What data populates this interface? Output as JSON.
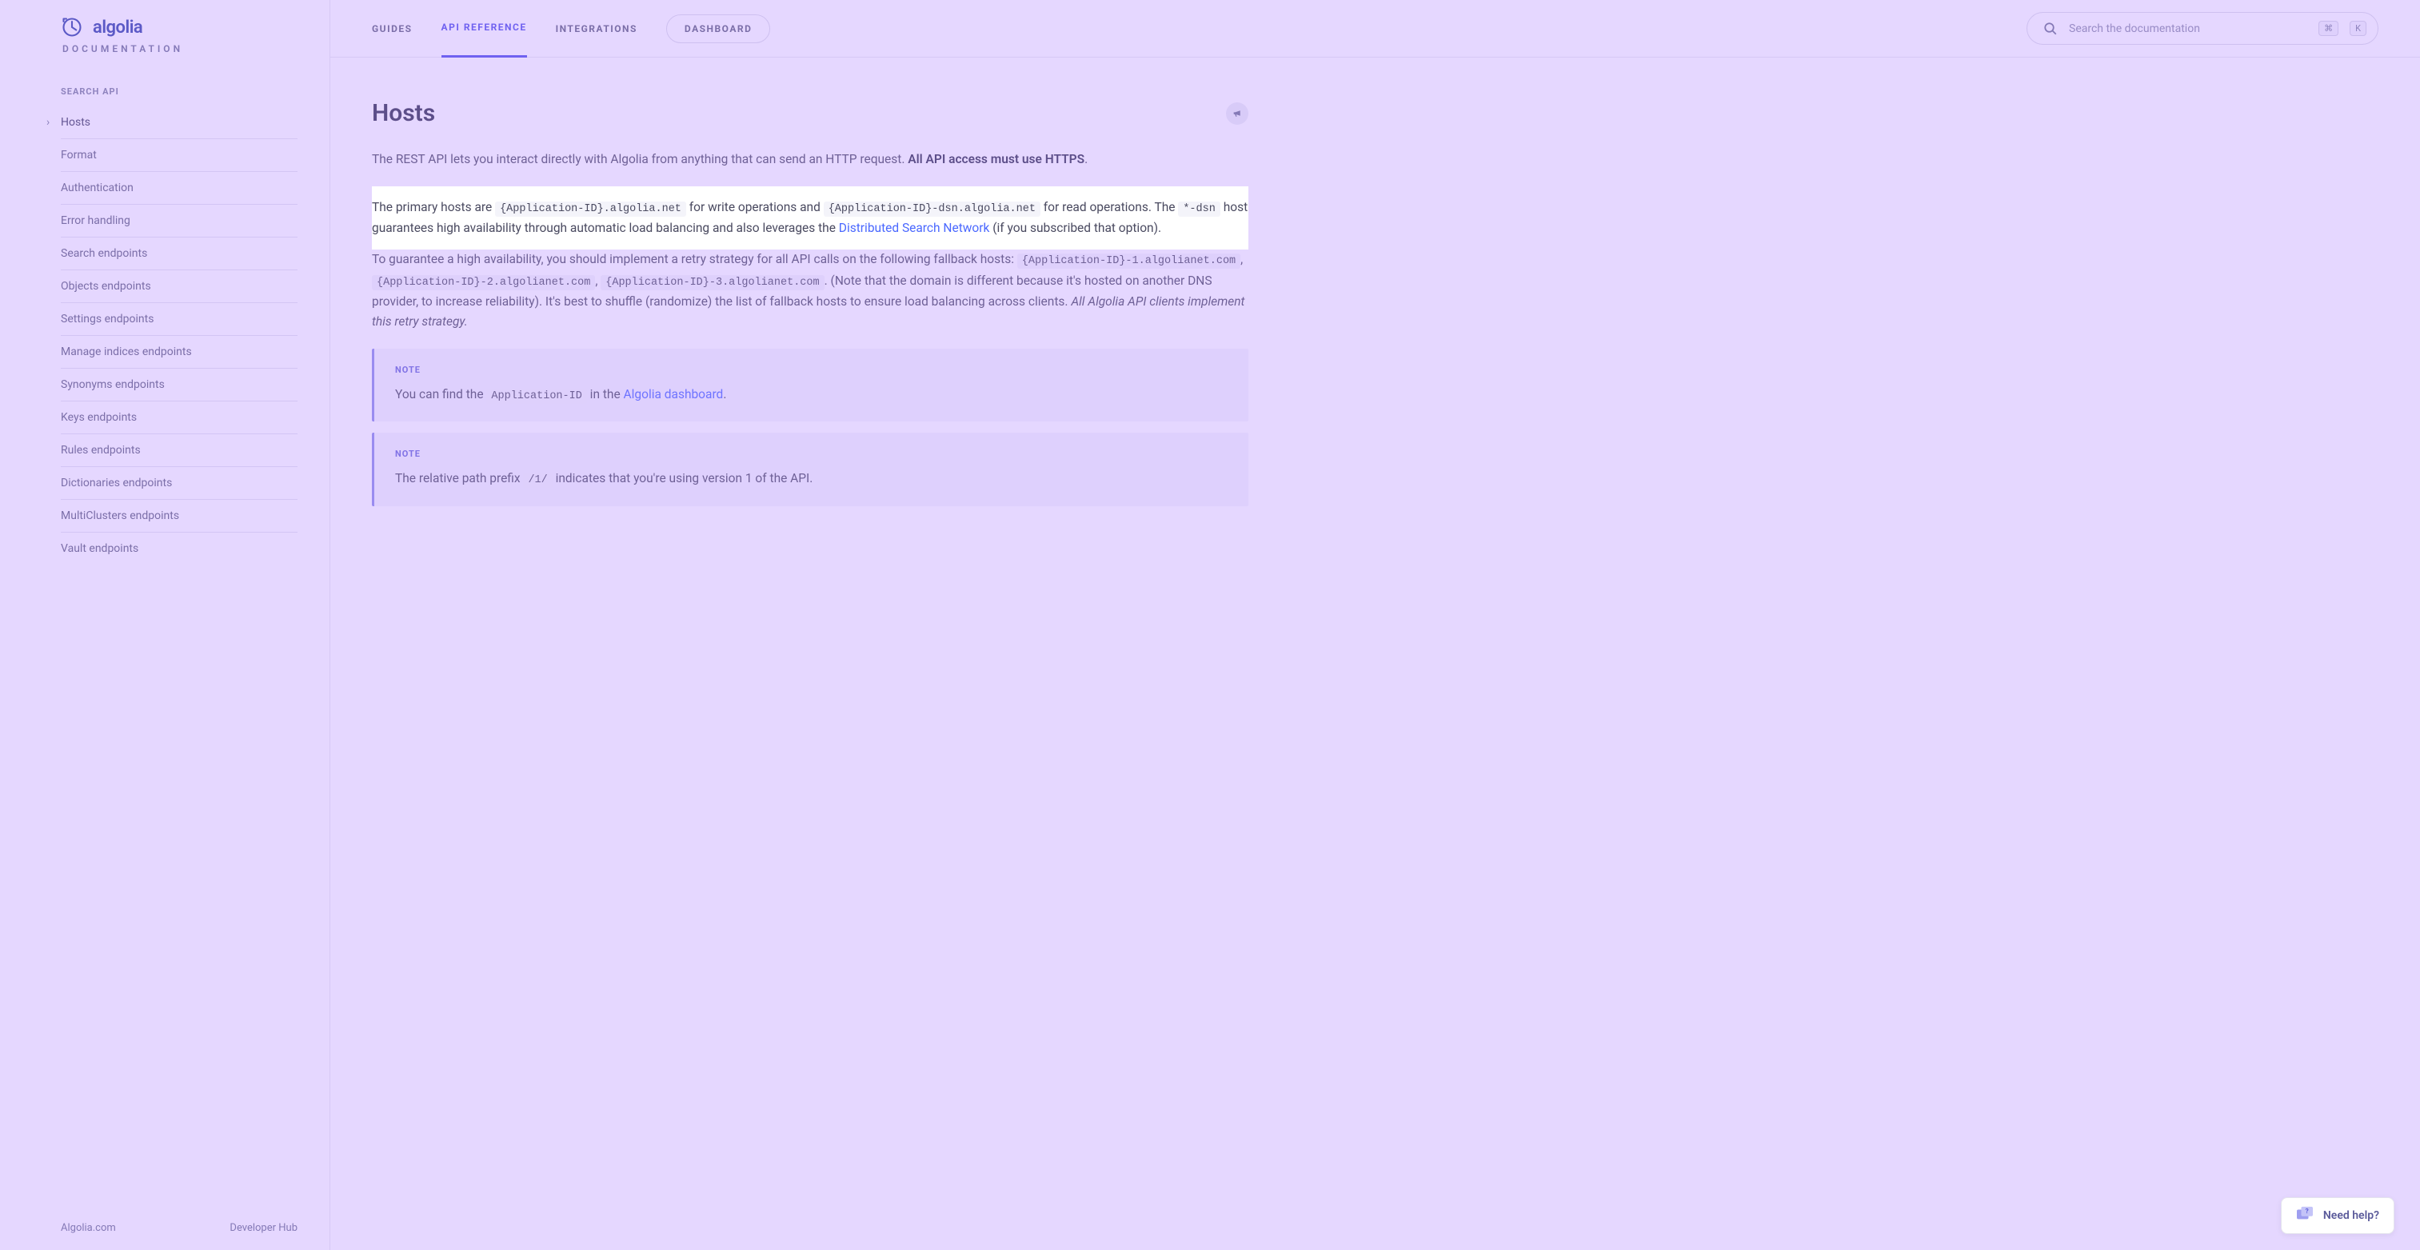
{
  "brand": {
    "name": "algolia",
    "subtitle": "DOCUMENTATION"
  },
  "sidebar": {
    "section_label": "SEARCH API",
    "items": [
      {
        "label": "Hosts",
        "active": true
      },
      {
        "label": "Format"
      },
      {
        "label": "Authentication"
      },
      {
        "label": "Error handling"
      },
      {
        "label": "Search endpoints"
      },
      {
        "label": "Objects endpoints"
      },
      {
        "label": "Settings endpoints"
      },
      {
        "label": "Manage indices endpoints"
      },
      {
        "label": "Synonyms endpoints"
      },
      {
        "label": "Keys endpoints"
      },
      {
        "label": "Rules endpoints"
      },
      {
        "label": "Dictionaries endpoints"
      },
      {
        "label": "MultiClusters endpoints"
      },
      {
        "label": "Vault endpoints"
      }
    ],
    "footer": {
      "left": "Algolia.com",
      "right": "Developer Hub"
    }
  },
  "topnav": {
    "tabs": [
      {
        "label": "GUIDES"
      },
      {
        "label": "API REFERENCE",
        "active": true
      },
      {
        "label": "INTEGRATIONS"
      }
    ],
    "dashboard": "DASHBOARD"
  },
  "search": {
    "placeholder": "Search the documentation",
    "shortcut_mod": "⌘",
    "shortcut_key": "K"
  },
  "page": {
    "title": "Hosts",
    "intro_pre": "The REST API lets you interact directly with Algolia from anything that can send an HTTP request. ",
    "intro_strong": "All API access must use HTTPS",
    "intro_post": ".",
    "p2_a": "The primary hosts are ",
    "p2_code1": "{Application-ID}.algolia.net",
    "p2_b": " for write operations and ",
    "p2_code2": "{Application-ID}-dsn.algolia.net",
    "p2_c": " for read operations. The ",
    "p2_code3": "*-dsn",
    "p2_d": " host guarantees high availability through automatic load balancing and also leverages the ",
    "p2_link": "Distributed Search Network",
    "p2_e": " (if you subscribed that option).",
    "p3_a": "To guarantee a high availability, you should implement a retry strategy for all API calls on the following fallback hosts: ",
    "p3_code1": "{Application-ID}-1.algolianet.com",
    "p3_sep": ", ",
    "p3_code2": "{Application-ID}-2.algolianet.com",
    "p3_code3": "{Application-ID}-3.algolianet.com",
    "p3_b": ". (Note that the domain is different because it's hosted on another DNS provider, to increase reliability). It's best to shuffle (randomize) the list of fallback hosts to ensure load balancing across clients. ",
    "p3_em": "All Algolia API clients implement this retry strategy.",
    "note_label": "NOTE",
    "note1_a": "You can find the ",
    "note1_code": "Application-ID",
    "note1_b": " in the ",
    "note1_link": "Algolia dashboard",
    "note1_c": ".",
    "note2_a": "The relative path prefix ",
    "note2_code": "/1/",
    "note2_b": " indicates that you're using version 1 of the API."
  },
  "help": {
    "label": "Need help?"
  }
}
